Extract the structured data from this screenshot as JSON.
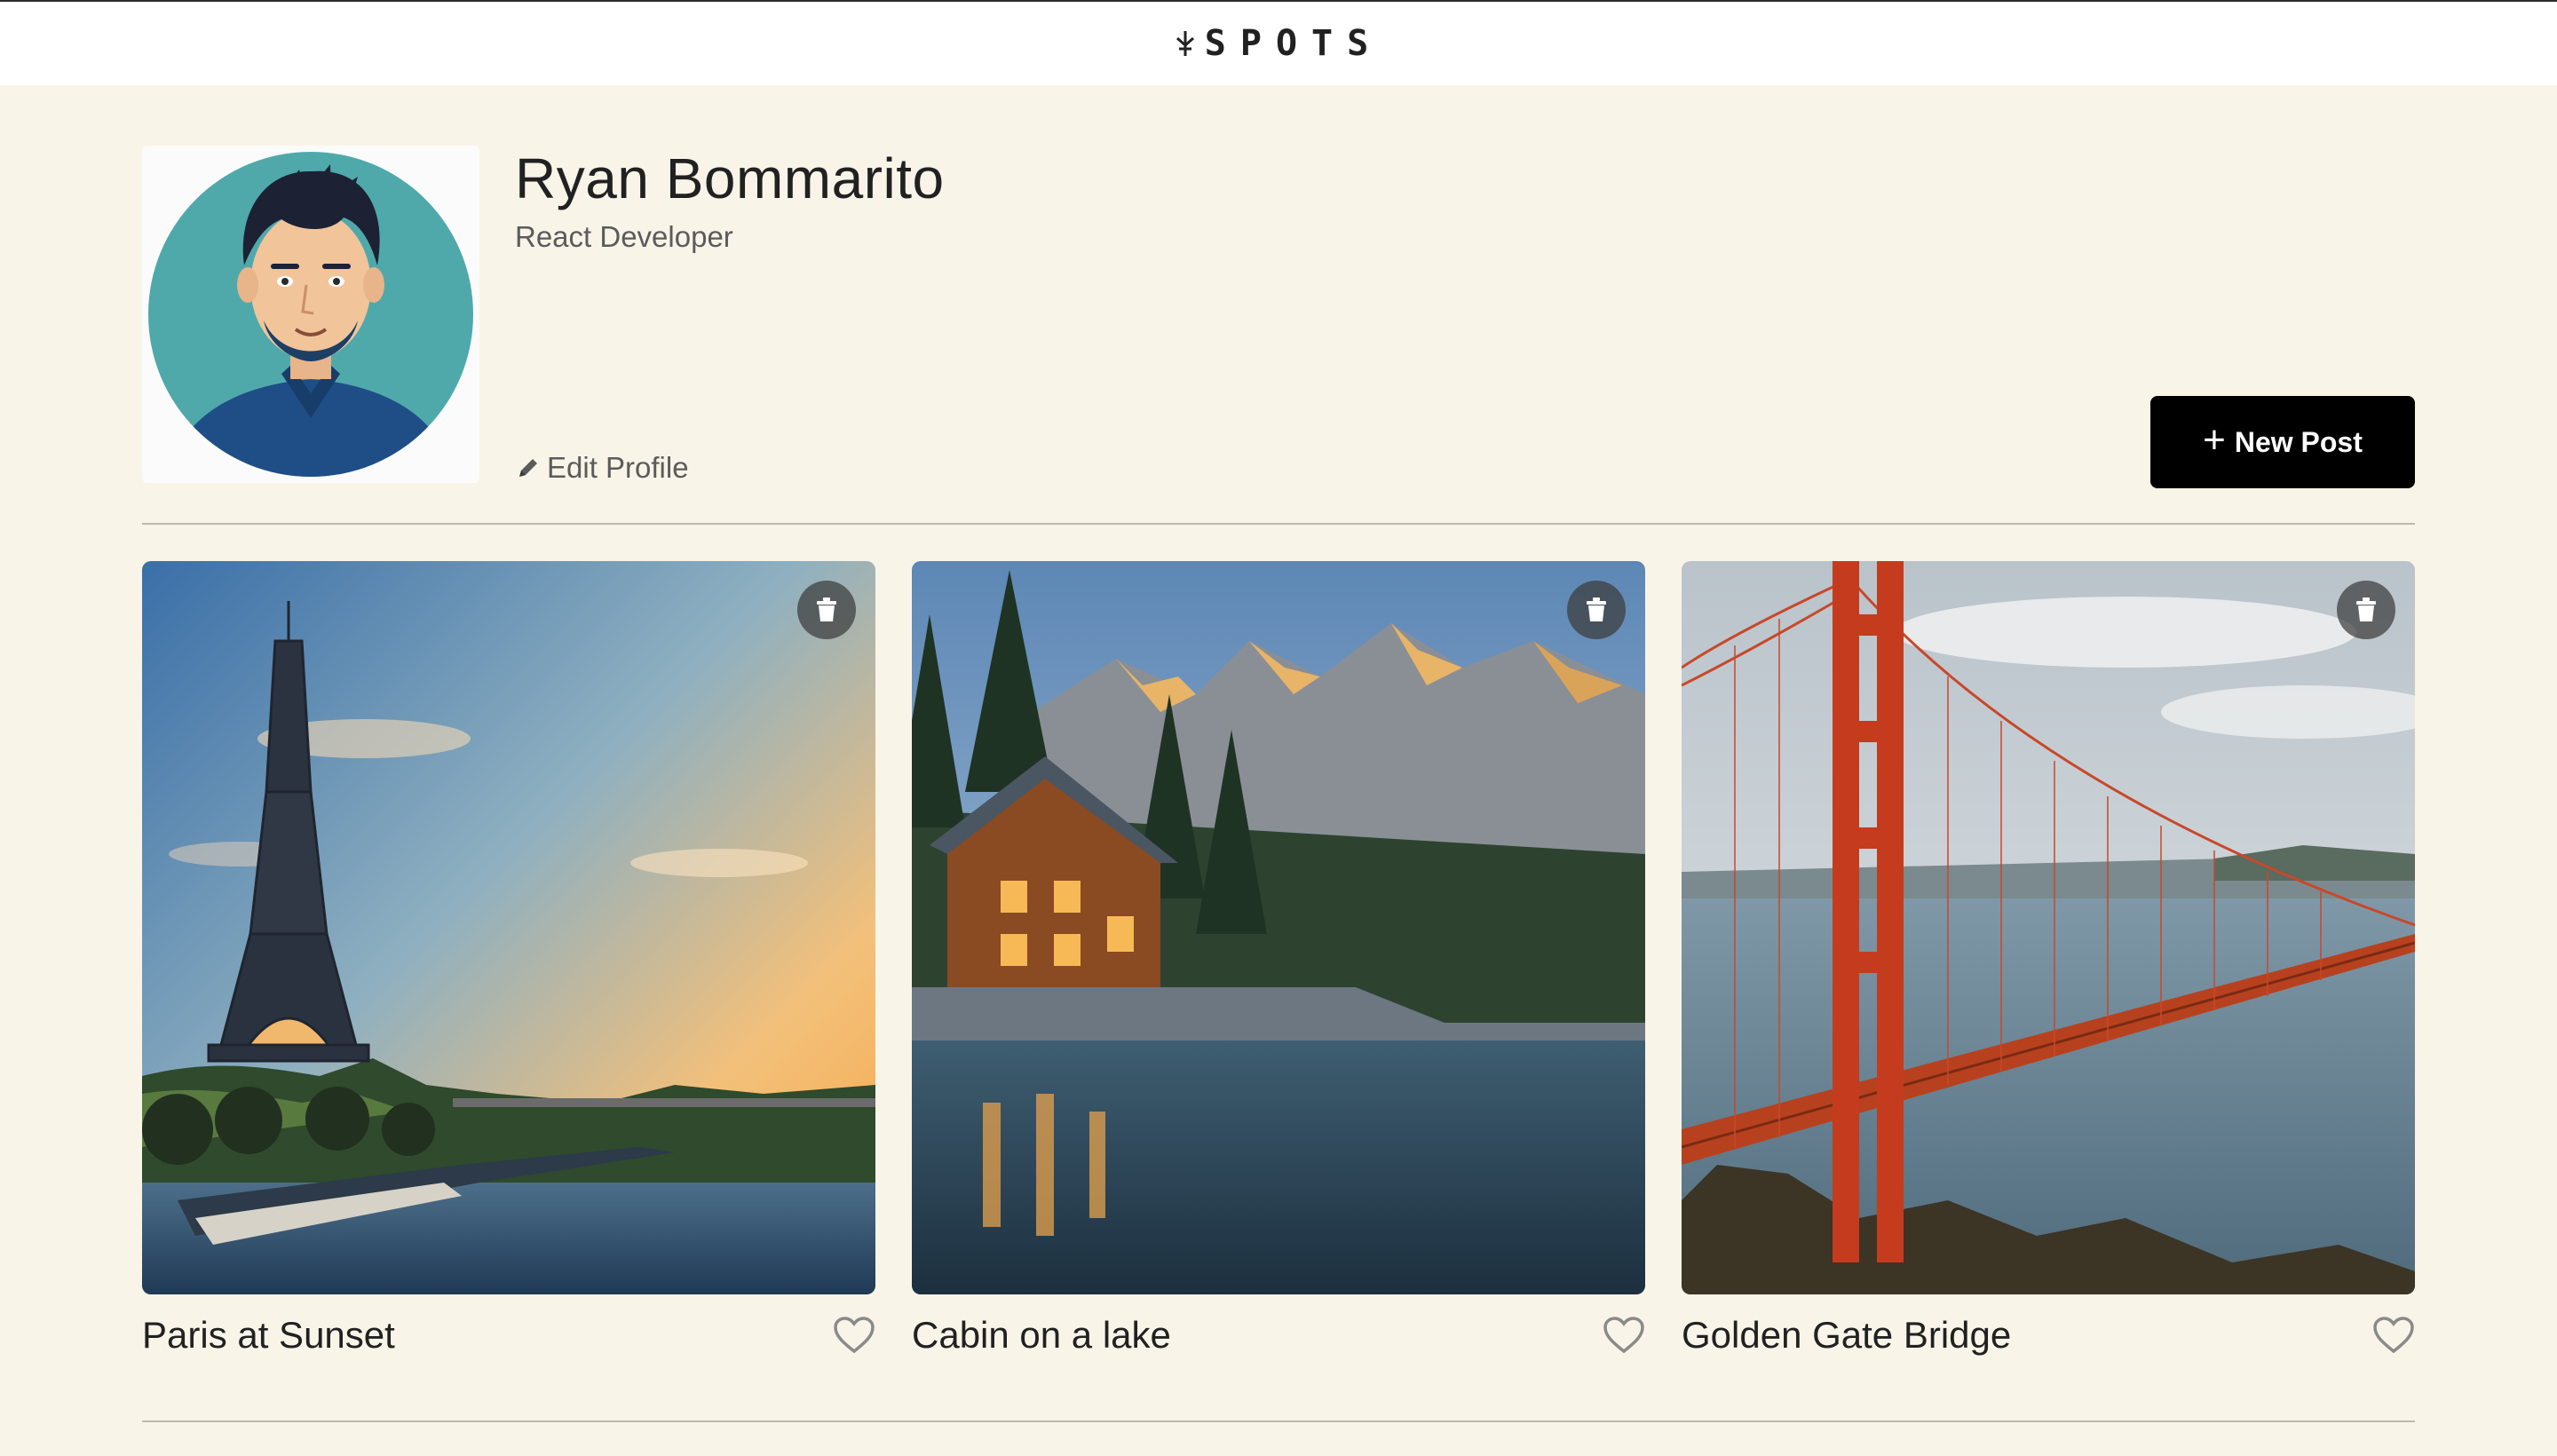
{
  "header": {
    "logo_text": "SPOTS",
    "logo_icon": "compass-pin-icon"
  },
  "profile": {
    "name": "Ryan Bommarito",
    "role": "React Developer",
    "edit_label": "Edit Profile",
    "new_post_label": "New Post"
  },
  "cards": [
    {
      "title": "Paris at Sunset"
    },
    {
      "title": "Cabin on a lake"
    },
    {
      "title": "Golden Gate Bridge"
    }
  ],
  "colors": {
    "background": "#f9f4e8",
    "header": "#ffffff",
    "text": "#212121",
    "muted": "#5b5b5b",
    "button": "#000000"
  }
}
